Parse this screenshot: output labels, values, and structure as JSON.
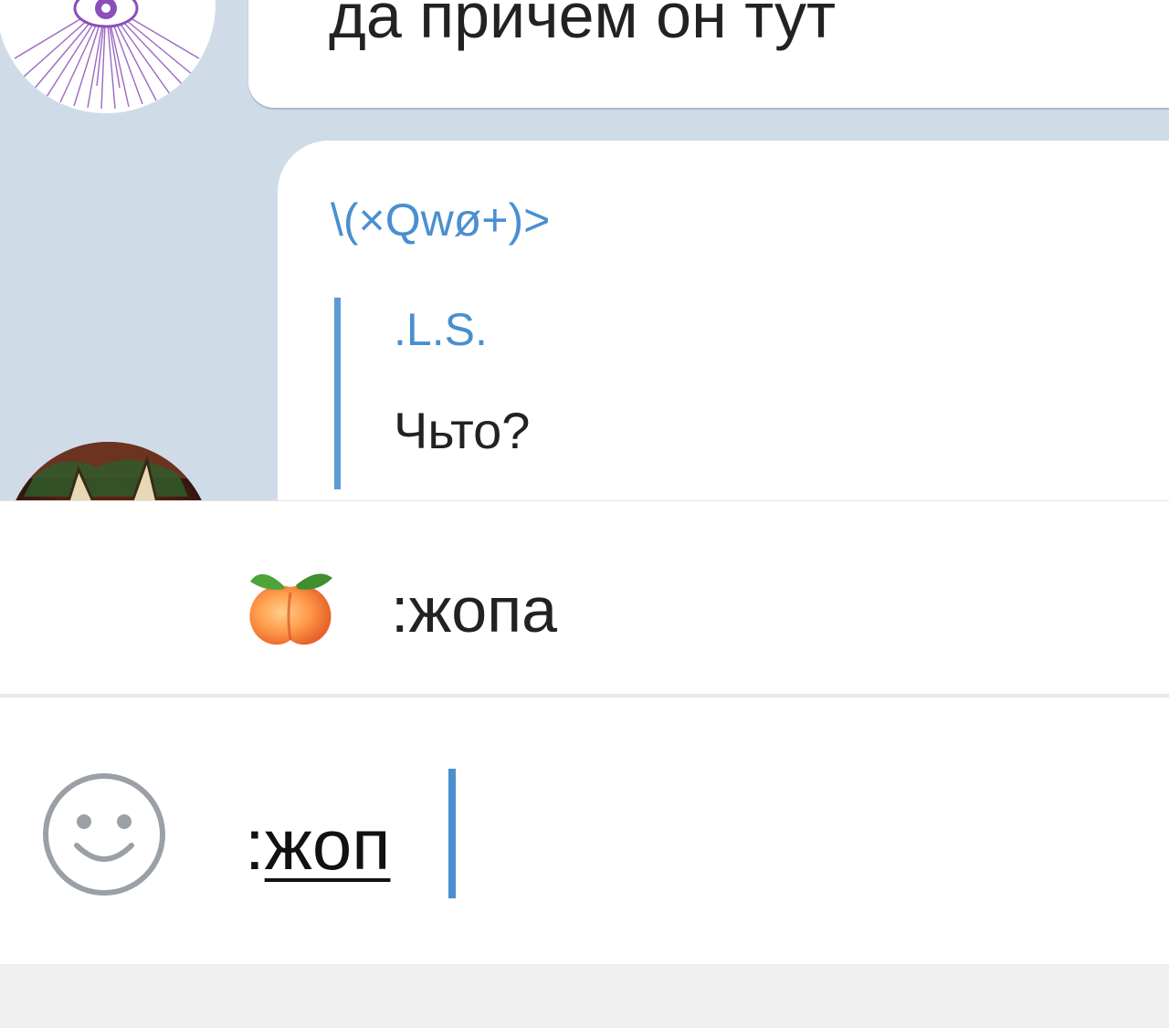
{
  "chat": {
    "previous_message": {
      "text": "да причем он тут"
    },
    "current_message": {
      "sender": "\\(×Qwø+)>",
      "reply": {
        "author": ".L.S.",
        "text": "Чьто?"
      }
    }
  },
  "emoji_suggestions": [
    {
      "emoji": "🍑",
      "icon": "peach-icon",
      "shortcode": ":жопа"
    }
  ],
  "input": {
    "prefix": ":",
    "value_word": "жоп",
    "emoji_button_icon": "smiley-icon"
  },
  "colors": {
    "chat_background": "#cfdce8",
    "accent": "#4a8fd0",
    "reply_bar": "#5b9bd5",
    "caret": "#4a8fd0"
  }
}
